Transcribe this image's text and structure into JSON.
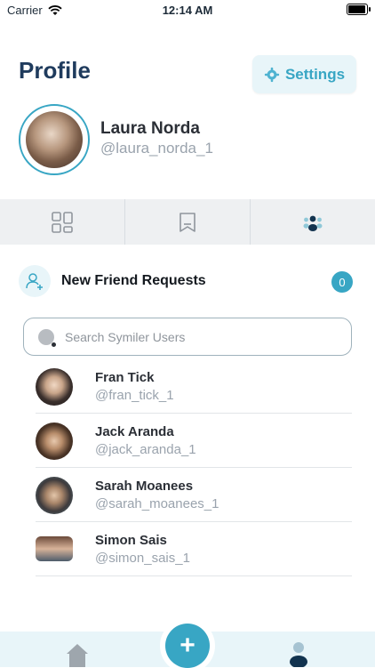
{
  "status_bar": {
    "carrier": "Carrier",
    "time": "12:14 AM"
  },
  "header": {
    "title": "Profile",
    "settings_label": "Settings"
  },
  "profile": {
    "name": "Laura Norda",
    "handle": "@laura_norda_1"
  },
  "tabs": [
    {
      "icon": "grid-icon"
    },
    {
      "icon": "bookmark-icon"
    },
    {
      "icon": "group-icon"
    }
  ],
  "friend_requests": {
    "label": "New Friend Requests",
    "count": "0"
  },
  "search": {
    "placeholder": "Search Symiler Users"
  },
  "users": [
    {
      "name": "Fran Tick",
      "handle": "@fran_tick_1"
    },
    {
      "name": "Jack Aranda",
      "handle": "@jack_aranda_1"
    },
    {
      "name": "Sarah Moanees",
      "handle": "@sarah_moanees_1"
    },
    {
      "name": "Simon Sais",
      "handle": "@simon_sais_1"
    }
  ],
  "bottom_nav": {
    "fab_label": "+"
  },
  "colors": {
    "accent": "#38a6c4",
    "title": "#1f3b5d",
    "tabs_bg": "#eef0f2",
    "bottom_bg": "#e8f5f9"
  }
}
